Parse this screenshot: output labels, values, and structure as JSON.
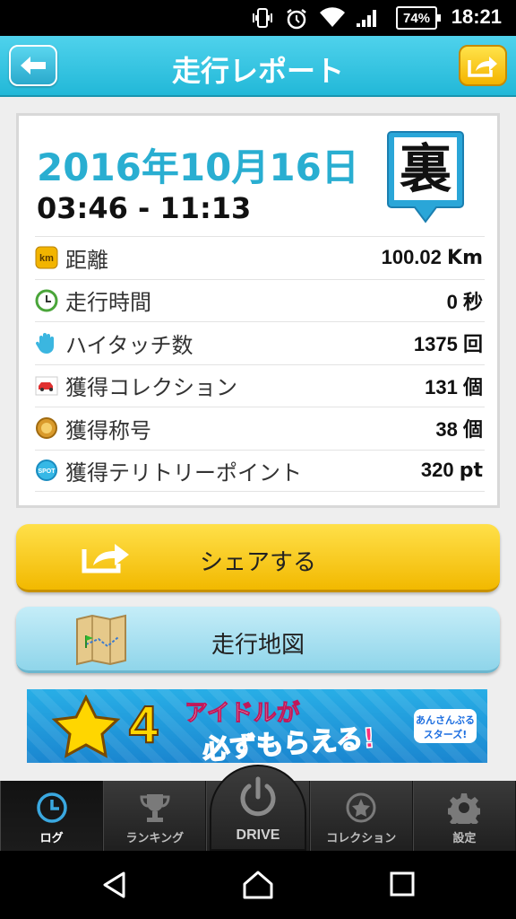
{
  "status_bar": {
    "battery": "74%",
    "time": "18:21"
  },
  "header": {
    "title": "走行レポート"
  },
  "report": {
    "date": "2016年10月16日",
    "time_range": "03:46 - 11:13",
    "badge_char": "裏",
    "stats": [
      {
        "icon": "km-icon",
        "label": "距離",
        "value": "100.02",
        "unit": "Km"
      },
      {
        "icon": "clock-icon",
        "label": "走行時間",
        "value": "0",
        "unit": "秒"
      },
      {
        "icon": "hand-icon",
        "label": "ハイタッチ数",
        "value": "1375",
        "unit": "回"
      },
      {
        "icon": "car-icon",
        "label": "獲得コレクション",
        "value": "131",
        "unit": "個"
      },
      {
        "icon": "medal-icon",
        "label": "獲得称号",
        "value": "38",
        "unit": "個"
      },
      {
        "icon": "spot-icon",
        "label": "獲得テリトリーポイント",
        "value": "320",
        "unit": "pt"
      }
    ]
  },
  "buttons": {
    "share": "シェアする",
    "map": "走行地図"
  },
  "ad": {
    "number": "4",
    "line1": "アイドルが",
    "line2": "必ずもらえる!",
    "logo": "あんさんぶるスターズ!"
  },
  "tabs": [
    {
      "label": "ログ",
      "icon": "clock-icon",
      "active": true
    },
    {
      "label": "ランキング",
      "icon": "trophy-icon",
      "active": false
    },
    {
      "label": "DRIVE",
      "icon": "power-icon",
      "active": false
    },
    {
      "label": "コレクション",
      "icon": "star-icon",
      "active": false
    },
    {
      "label": "設定",
      "icon": "gear-icon",
      "active": false
    }
  ],
  "colors": {
    "accent": "#29aed1",
    "header": "#22b8d8",
    "share_button": "#f2b900"
  }
}
